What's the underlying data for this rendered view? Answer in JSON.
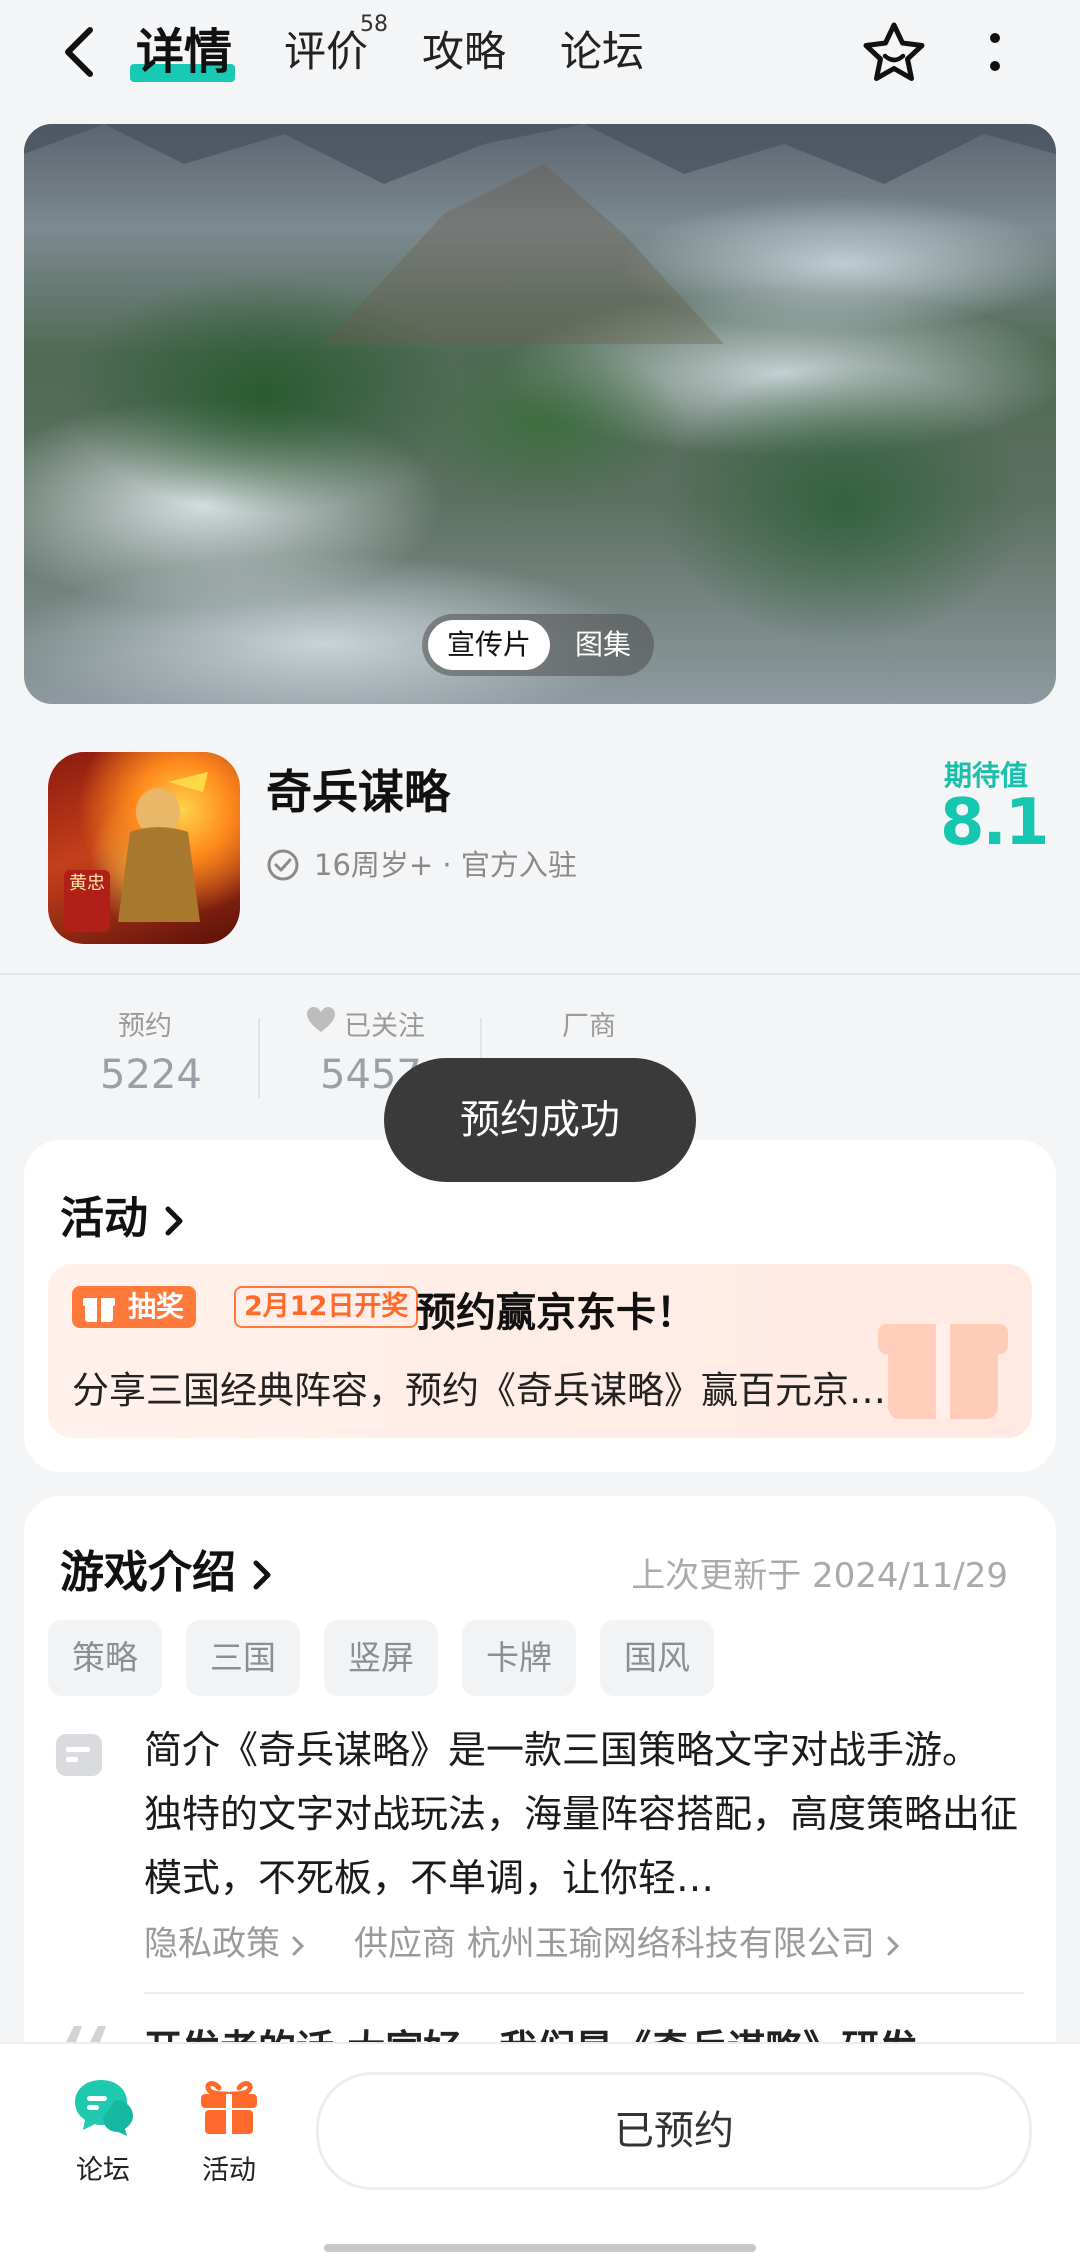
{
  "nav": {
    "tabs": [
      {
        "label": "详情"
      },
      {
        "label": "评价"
      },
      {
        "label": "攻略"
      },
      {
        "label": "论坛"
      }
    ],
    "review_count": "58"
  },
  "media": {
    "options": [
      "宣传片",
      "图集"
    ]
  },
  "app": {
    "name": "奇兵谋略",
    "meta": "16周岁+ · 官方入驻",
    "icon_seal": "黄忠",
    "expect_label": "期待值",
    "expect_score": "8.1"
  },
  "stats": [
    {
      "label": "预约",
      "value": "5224"
    },
    {
      "label": "已关注",
      "value": "5457"
    },
    {
      "label": "厂商",
      "value": ""
    }
  ],
  "toast": "预约成功",
  "activity": {
    "title": "活动",
    "tag": "抽奖",
    "date_tag": "2月12日开奖",
    "headline": "预约赢京东卡！",
    "desc": "分享三国经典阵容，预约《奇兵谋略》赢百元京…"
  },
  "intro": {
    "title": "游戏介绍",
    "updated": "上次更新于 2024/11/29",
    "tags": [
      "策略",
      "三国",
      "竖屏",
      "卡牌",
      "国风"
    ],
    "summary": "简介《奇兵谋略》是一款三国策略文字对战手游。 独特的文字对战玩法，海量阵容搭配，高度策略出征模式，不死板，不单调，让你轻…",
    "privacy": "隐私政策",
    "supplier": "供应商 杭州玉瑜网络科技有限公司",
    "dev_note": "开发者的话 大家好，我们是《奇兵谋略》研发"
  },
  "bottom": {
    "forum_label": "论坛",
    "activity_label": "活动",
    "reserve_button": "已预约"
  },
  "colors": {
    "accent": "#18c9b4",
    "orange": "#ff7a3a",
    "toast_bg": "#3a3a3a"
  }
}
